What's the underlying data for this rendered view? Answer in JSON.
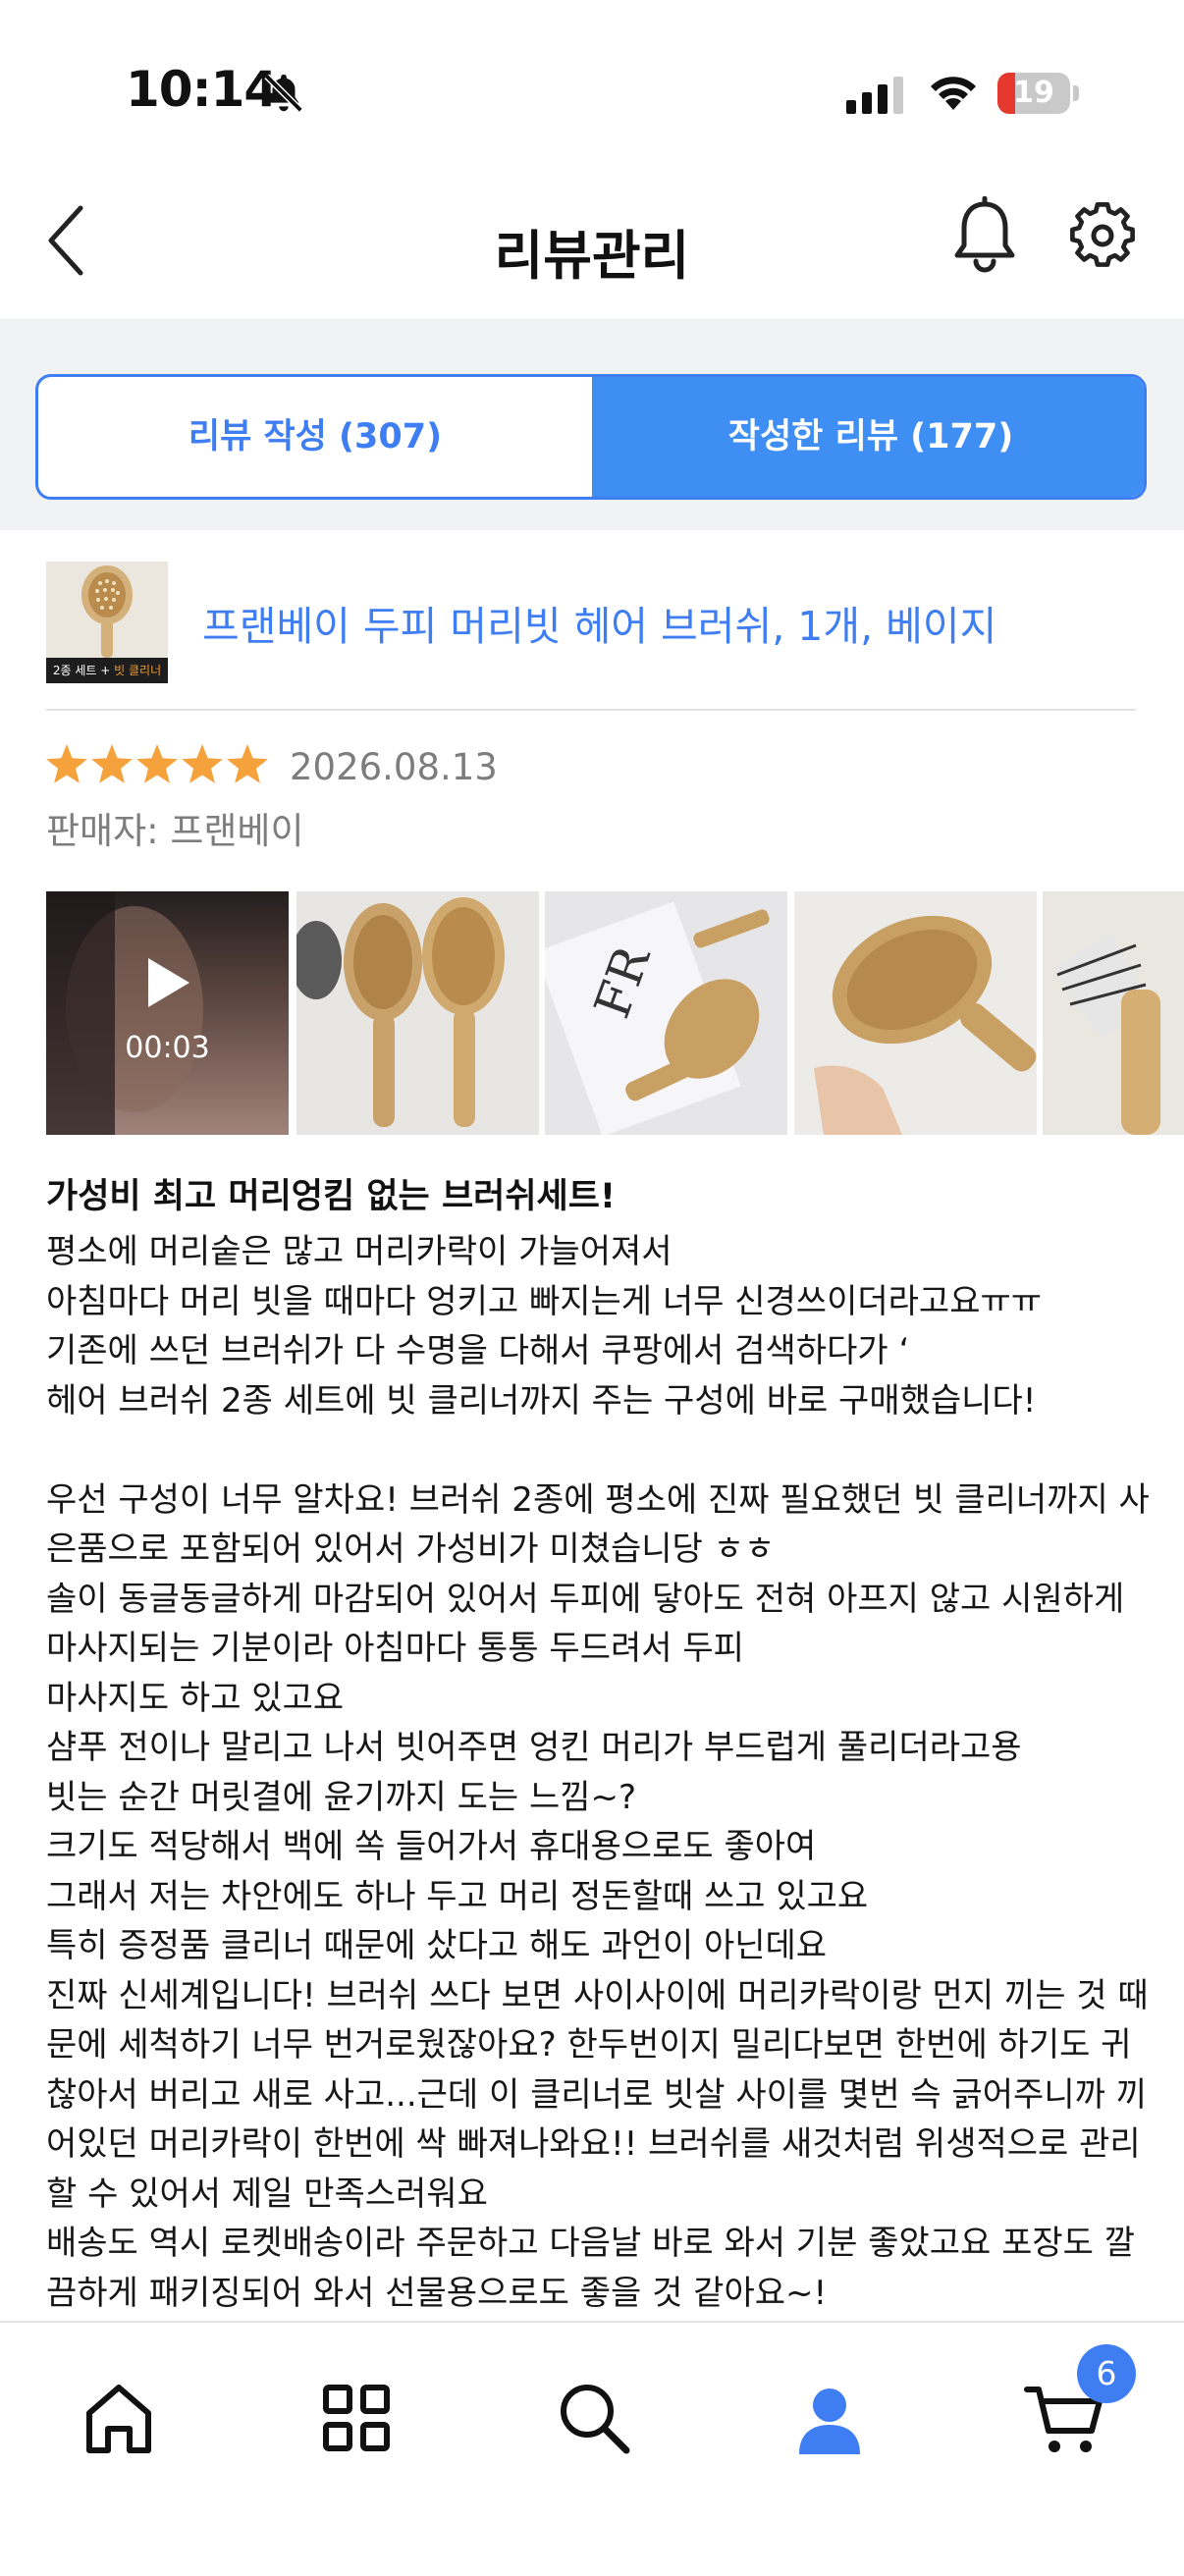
{
  "status_bar": {
    "time": "10:14",
    "battery": "19"
  },
  "header": {
    "title": "리뷰관리"
  },
  "tabs": [
    {
      "label": "리뷰 작성 (307)",
      "active": false
    },
    {
      "label": "작성한 리뷰 (177)",
      "active": true
    }
  ],
  "product": {
    "name": "프랜베이 두피 머리빗 헤어 브러쉬, 1개, 베이지",
    "thumb_label_white": "2종 세트 + ",
    "thumb_label_orange": "빗 클리너 증정"
  },
  "review": {
    "rating": 5,
    "date": "2026.08.13",
    "seller": "판매자: 프랜베이",
    "video_duration": "00:03",
    "title": "가성비 최고 머리엉킴 없는 브러쉬세트!",
    "lines": [
      "평소에 머리숱은 많고 머리카락이 가늘어져서",
      "아침마다 머리 빗을 때마다 엉키고 빠지는게 너무 신경쓰이더라고요ㅠㅠ",
      "기존에 쓰던 브러쉬가 다 수명을 다해서 쿠팡에서 검색하다가 ‘",
      "헤어 브러쉬 2종 세트에 빗 클리너까지 주는 구성에 바로 구매했습니다!",
      "",
      "우선 구성이 너무 알차요! 브러쉬 2종에 평소에 진짜 필요했던 빗 클리너까지 사",
      "은품으로 포함되어 있어서 가성비가 미쳤습니당 ㅎㅎ",
      "솔이 동글동글하게 마감되어 있어서 두피에 닿아도 전혀 아프지 않고 시원하게",
      "마사지되는 기분이라 아침마다 통통 두드려서 두피",
      "마사지도 하고 있고요",
      "샴푸 전이나 말리고 나서 빗어주면 엉킨 머리가 부드럽게 풀리더라고용",
      "빗는 순간 머릿결에 윤기까지 도는 느낌~?",
      "크기도 적당해서 백에 쏙 들어가서 휴대용으로도 좋아여",
      "그래서 저는 차안에도 하나 두고 머리 정돈할때 쓰고 있고요",
      "특히 증정품 클리너 때문에 샀다고 해도 과언이 아닌데요",
      "진짜 신세계입니다! 브러쉬 쓰다 보면 사이사이에 머리카락이랑 먼지 끼는 것 때",
      "문에 세척하기 너무 번거로웠잖아요? 한두번이지 밀리다보면 한번에 하기도 귀",
      "찮아서 버리고 새로 사고...근데 이 클리너로 빗살 사이를 몇번 슥 긁어주니까 끼",
      "어있던 머리카락이 한번에 싹 빠져나와요!! 브러쉬를 새것처럼 위생적으로 관리",
      "할 수 있어서 제일 만족스러워요",
      "배송도 역시 로켓배송이라 주문하고 다음날 바로 와서 기분 좋았고요 포장도 깔",
      "끔하게 패키징되어 와서 선물용으로도 좋을 것 같아요~!"
    ]
  },
  "bottom_nav": {
    "cart_count": "6"
  },
  "colors": {
    "accent": "#3f7ef2",
    "star": "#f5a23c"
  }
}
